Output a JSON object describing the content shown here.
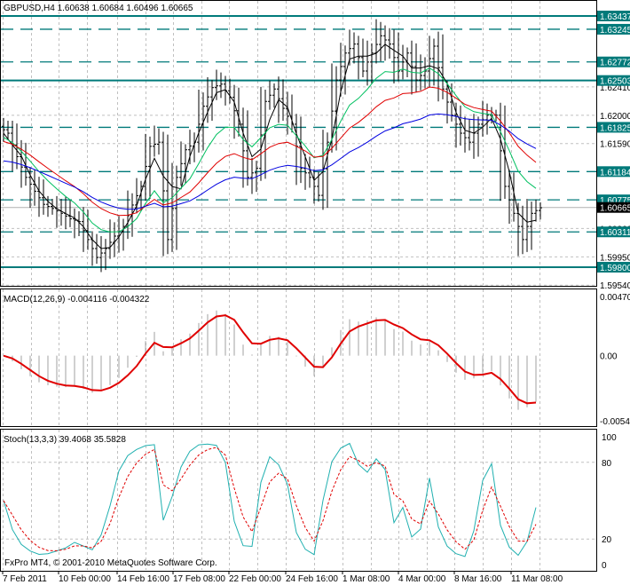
{
  "header": {
    "title": "GBPUSD,H4  1.60638 1.60684 1.60496 1.60665"
  },
  "footer": {
    "copyright": "FxPro MT4, © 2001-2010 MetaQuotes Software Corp."
  },
  "colors": {
    "level": "#007a7a",
    "bull": "#000000",
    "ma_fast": "#000000",
    "ma_mid": "#00c060",
    "ma_slow_red": "#e00000",
    "ma_long": "#0000e0",
    "macd": "#e00000",
    "stoch_main": "#20b0b0",
    "stoch_signal": "#e00000"
  },
  "chart_data": [
    {
      "type": "line",
      "title": "GBPUSD,H4",
      "ylim": [
        1.5954,
        1.6355
      ],
      "price_labels": [
        "1.62410",
        "1.62000",
        "1.61590",
        "1.60360",
        "1.59950",
        "1.59540"
      ],
      "price_values": [
        1.6241,
        1.62,
        1.6159,
        1.6036,
        1.5995,
        1.5954
      ],
      "levels": [
        {
          "label": "1.63437",
          "value": 1.63437,
          "style": "solid"
        },
        {
          "label": "1.63245",
          "value": 1.63245,
          "style": "dash"
        },
        {
          "label": "1.62772",
          "value": 1.62772,
          "style": "dash"
        },
        {
          "label": "1.62503",
          "value": 1.62503,
          "style": "solid"
        },
        {
          "label": "1.61825",
          "value": 1.61825,
          "style": "dash"
        },
        {
          "label": "1.61184",
          "value": 1.61184,
          "style": "dash"
        },
        {
          "label": "1.60775",
          "value": 1.60775,
          "style": "dash"
        },
        {
          "label": "1.60311",
          "value": 1.60311,
          "style": "dash"
        },
        {
          "label": "1.59800",
          "value": 1.598,
          "style": "solid"
        }
      ],
      "current": {
        "label": "1.60665",
        "value": 1.60665
      },
      "closes": [
        1.6174,
        1.614,
        1.611,
        1.609,
        1.6071,
        1.6065,
        1.6058,
        1.605,
        1.6046,
        1.602,
        1.5994,
        1.6007,
        1.6025,
        1.6039,
        1.607,
        1.6097,
        1.6155,
        1.6161,
        1.602,
        1.611,
        1.615,
        1.6161,
        1.6213,
        1.624,
        1.6245,
        1.6226,
        1.6187,
        1.611,
        1.6123,
        1.622,
        1.6238,
        1.621,
        1.6187,
        1.6123,
        1.611,
        1.6084,
        1.6161,
        1.6251,
        1.629,
        1.6303,
        1.6264,
        1.629,
        1.6315,
        1.6303,
        1.6264,
        1.629,
        1.6251,
        1.6264,
        1.63,
        1.6238,
        1.62,
        1.6174,
        1.6161,
        1.6187,
        1.62,
        1.62,
        1.6097,
        1.6058,
        1.602,
        1.6058,
        1.6066
      ]
    },
    {
      "type": "line",
      "title": "MACD(12,26,9) -0.004116 -0.004322",
      "ylim": [
        -0.00545,
        0.0047
      ],
      "tick_labels": [
        "0.00470",
        "0.00",
        "-0.00545"
      ]
    },
    {
      "type": "line",
      "title": "Stoch(13,3,3) 39.4068 35.5828",
      "ylim": [
        0,
        100
      ],
      "tick_labels": [
        "100",
        "80",
        "20",
        "0"
      ]
    }
  ],
  "time_axis": [
    "7 Feb 2011",
    "10 Feb 00:00",
    "14 Feb 16:00",
    "17 Feb 08:00",
    "22 Feb 00:00",
    "24 Feb 16:00",
    "1 Mar 08:00",
    "4 Mar 00:00",
    "8 Mar 16:00",
    "11 Mar 08:00"
  ]
}
